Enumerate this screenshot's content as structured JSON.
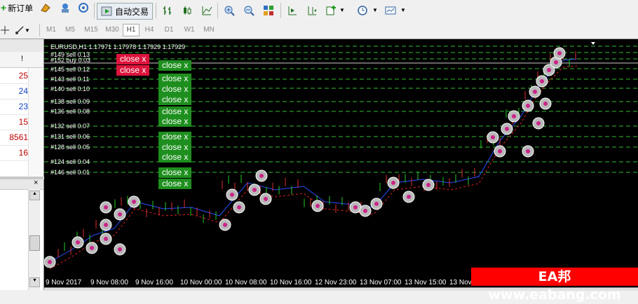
{
  "toolbar": {
    "new_order_label": "新订单",
    "autotrade_label": "自动交易"
  },
  "timeframes": [
    "M1",
    "M5",
    "M15",
    "M30",
    "H1",
    "H4",
    "D1",
    "W1",
    "MN"
  ],
  "selected_timeframe": "H1",
  "left_panel": {
    "header_symbol": "!",
    "values": [
      "25",
      "24",
      "23",
      "15",
      "8561",
      "16"
    ],
    "value_colors": [
      "#c00000",
      "#1040c0",
      "#1040c0",
      "#c00000",
      "#c00000",
      "#c00000"
    ]
  },
  "chart": {
    "header": "EURUSD,H1  1.17971 1.17978 1.17929 1.17929",
    "orders": [
      "#149 sell 0.13",
      "#152 buy 0.03",
      "#145 sell 0.12",
      "#143 sell 0.11",
      "#140 sell 0.10",
      "#138 sell 0.09",
      "#136 sell 0.08",
      "#132 sell 0.07",
      "#131 sell 0.06",
      "#128 sell 0.05",
      "#124 sell 0.04",
      "#146 sell 0.01"
    ],
    "close_label": "close x",
    "x_labels": [
      "9 Nov 2017",
      "9 Nov 08:00",
      "9 Nov 16:00",
      "10 Nov 00:00",
      "10 Nov 08:00",
      "10 Nov 16:00",
      "12 Nov 23:00",
      "13 Nov 07:00",
      "13 Nov 15:00",
      "13 Nov 2"
    ]
  },
  "watermark": "EA邦 www.eabang.com",
  "colors": {
    "chart_bg": "#000000",
    "close_red": "#dc143c",
    "close_green": "#1e8f1e",
    "level_line": "#33bb33"
  }
}
